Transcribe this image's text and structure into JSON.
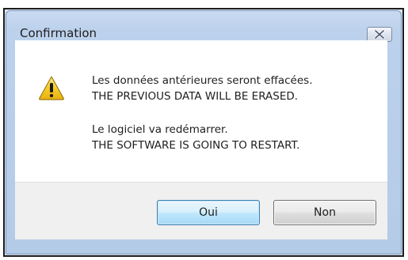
{
  "dialog": {
    "title": "Confirmation",
    "close_icon": "close-x-icon",
    "warning_icon": "warning-triangle-icon",
    "message_lines": [
      "Les données antérieures seront effacées.",
      "THE PREVIOUS DATA WILL BE ERASED.",
      "Le logiciel va redémarrer.",
      "THE SOFTWARE IS GOING TO RESTART."
    ],
    "buttons": {
      "yes_label": "Oui",
      "no_label": "Non"
    },
    "colors": {
      "warning_fill": "#f2c418",
      "warning_border": "#9a7a12",
      "default_button_border": "#3c7fb1"
    }
  }
}
